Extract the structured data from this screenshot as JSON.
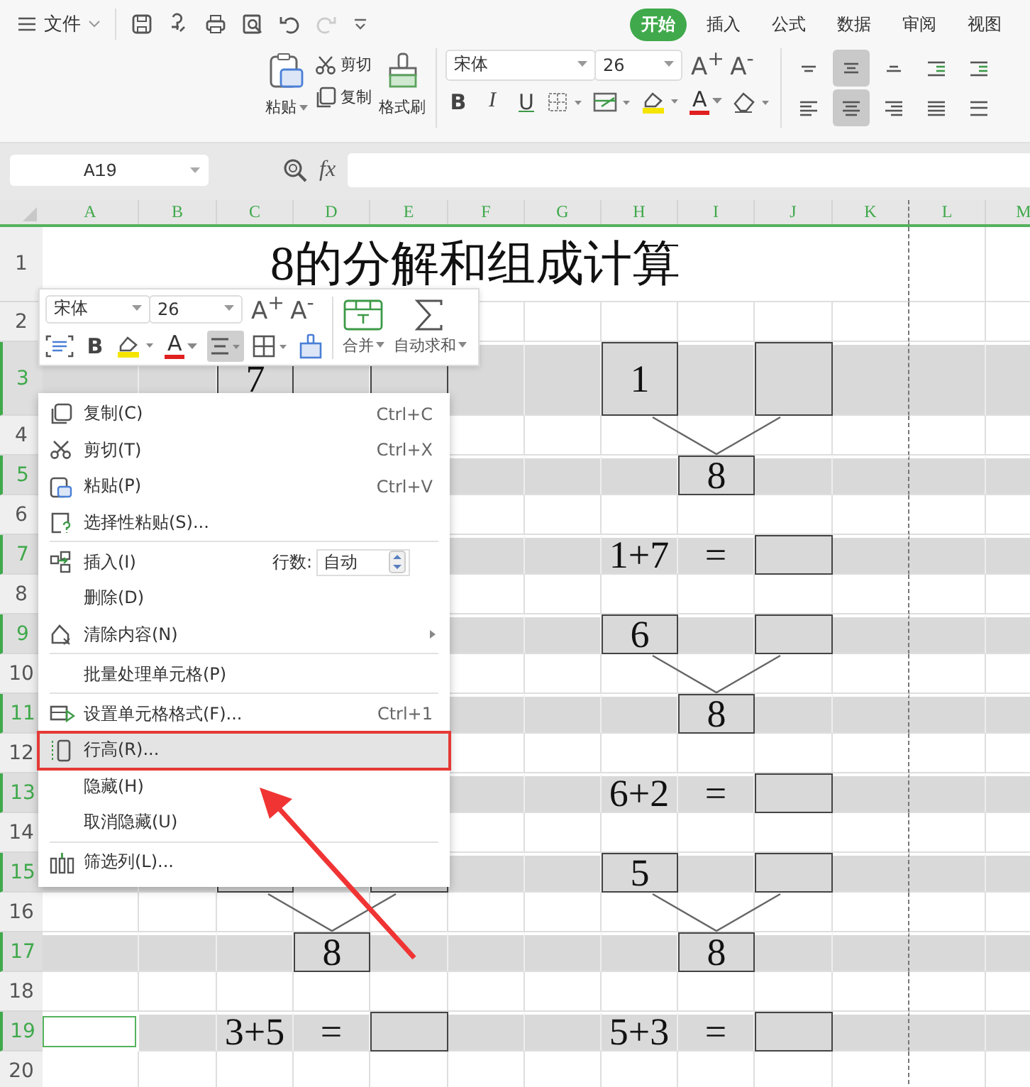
{
  "menu_bar": {
    "file_menu": "文件",
    "tabs": [
      {
        "label": "开始",
        "selected": true
      },
      {
        "label": "插入",
        "selected": false
      },
      {
        "label": "公式",
        "selected": false
      },
      {
        "label": "数据",
        "selected": false
      },
      {
        "label": "审阅",
        "selected": false
      },
      {
        "label": "视图",
        "selected": false
      }
    ]
  },
  "ribbon": {
    "paste": "粘贴",
    "cut": "剪切",
    "copy": "复制",
    "format_painter": "格式刷",
    "font_name": "宋体",
    "font_size": "26",
    "grow_font": "A$^{+}$",
    "shrink_font": "A$^{-}$",
    "format_buttons": [
      {
        "kind": "bold",
        "glyph": "B"
      },
      {
        "kind": "italic",
        "glyph": "I"
      },
      {
        "kind": "underline",
        "glyph": "U"
      }
    ],
    "font_color_glyph": "A",
    "alignment": [
      {
        "selected": false
      },
      {
        "selected": true
      },
      {
        "selected": false
      },
      {
        "selected": false
      },
      {
        "selected": false
      },
      {
        "selected": false
      },
      {
        "selected": true
      },
      {
        "selected": false
      },
      {
        "selected": false
      },
      {
        "selected": false
      }
    ]
  },
  "formula_bar": {
    "name_box": "A19",
    "fx": "fx"
  },
  "sheet": {
    "columns": [
      "A",
      "B",
      "C",
      "D",
      "E",
      "F",
      "G",
      "H",
      "I",
      "J",
      "K",
      "L",
      "M"
    ],
    "rows": [
      {
        "number": "1",
        "selected": false,
        "title": "8的分解和组成计算"
      },
      {
        "number": "2",
        "selected": false
      },
      {
        "number": "3",
        "selected": true,
        "cells": [
          {
            "boxed": false
          },
          {
            "boxed": false
          },
          {
            "text": "7",
            "boxed": true
          },
          {
            "boxed": false
          },
          {
            "boxed": true
          },
          {
            "boxed": false
          },
          {
            "boxed": false
          },
          {
            "text": "1",
            "boxed": true
          },
          {
            "boxed": false
          },
          {
            "boxed": true
          },
          {
            "boxed": false
          },
          {
            "boxed": false
          },
          {
            "boxed": false
          }
        ]
      },
      {
        "number": "4",
        "selected": false,
        "cells": [
          {},
          {},
          {},
          {},
          {},
          {
            "boxed": false,
            "split_lines": false
          },
          {
            "boxed": false,
            "split_lines": false
          },
          {
            "boxed": false,
            "split_lines": false
          },
          {
            "boxed": false,
            "split_lines": true
          },
          {
            "boxed": false,
            "split_lines": false
          },
          {
            "boxed": false,
            "split_lines": false
          },
          {
            "boxed": false,
            "split_lines": false
          },
          {
            "boxed": false,
            "split_lines": false
          }
        ]
      },
      {
        "number": "5",
        "selected": true,
        "cells": [
          {},
          {},
          {},
          {},
          {},
          {
            "boxed": false
          },
          {
            "boxed": false
          },
          {
            "boxed": false
          },
          {
            "text": "8",
            "boxed": true
          },
          {
            "boxed": false
          },
          {
            "boxed": false
          },
          {
            "boxed": false
          },
          {
            "boxed": false
          }
        ]
      },
      {
        "number": "6",
        "selected": false
      },
      {
        "number": "7",
        "selected": true,
        "cells": [
          {},
          {},
          {},
          {},
          {},
          {
            "boxed": false
          },
          {
            "boxed": false
          },
          {
            "text": "1+7",
            "boxed": false
          },
          {
            "text": "=",
            "boxed": false
          },
          {
            "boxed": true
          },
          {
            "boxed": false
          },
          {
            "boxed": false
          },
          {
            "boxed": false
          }
        ]
      },
      {
        "number": "8",
        "selected": false
      },
      {
        "number": "9",
        "selected": true,
        "cells": [
          {},
          {},
          {},
          {},
          {},
          {
            "boxed": false
          },
          {
            "boxed": false
          },
          {
            "text": "6",
            "boxed": true
          },
          {
            "boxed": false
          },
          {
            "boxed": true
          },
          {
            "boxed": false
          },
          {
            "boxed": false
          },
          {
            "boxed": false
          }
        ]
      },
      {
        "number": "10",
        "selected": false,
        "cells": [
          {},
          {},
          {},
          {},
          {},
          {
            "boxed": false,
            "split_lines": false
          },
          {
            "boxed": false,
            "split_lines": false
          },
          {
            "boxed": false,
            "split_lines": false
          },
          {
            "boxed": false,
            "split_lines": true
          },
          {
            "boxed": false,
            "split_lines": false
          },
          {
            "boxed": false,
            "split_lines": false
          },
          {
            "boxed": false,
            "split_lines": false
          },
          {
            "boxed": false,
            "split_lines": false
          }
        ]
      },
      {
        "number": "11",
        "selected": true,
        "cells": [
          {},
          {},
          {},
          {},
          {},
          {
            "boxed": false
          },
          {
            "boxed": false
          },
          {
            "boxed": false
          },
          {
            "text": "8",
            "boxed": true
          },
          {
            "boxed": false
          },
          {
            "boxed": false
          },
          {
            "boxed": false
          },
          {
            "boxed": false
          }
        ]
      },
      {
        "number": "12",
        "selected": false
      },
      {
        "number": "13",
        "selected": true,
        "cells": [
          {},
          {},
          {},
          {},
          {},
          {
            "boxed": false
          },
          {
            "boxed": false
          },
          {
            "text": "6+2",
            "boxed": false
          },
          {
            "text": "=",
            "boxed": false
          },
          {
            "boxed": true
          },
          {
            "boxed": false
          },
          {
            "boxed": false
          },
          {
            "boxed": false
          }
        ]
      },
      {
        "number": "14",
        "selected": false
      },
      {
        "number": "15",
        "selected": true,
        "cells": [
          {
            "boxed": false
          },
          {
            "boxed": false
          },
          {
            "boxed": true
          },
          {
            "boxed": false
          },
          {
            "boxed": true
          },
          {
            "boxed": false
          },
          {
            "boxed": false
          },
          {
            "text": "5",
            "boxed": true
          },
          {
            "boxed": false
          },
          {
            "boxed": true
          },
          {
            "boxed": false
          },
          {
            "boxed": false
          },
          {
            "boxed": false
          }
        ]
      },
      {
        "number": "16",
        "selected": false,
        "cells": [
          {
            "boxed": false,
            "split_lines": false
          },
          {
            "boxed": false,
            "split_lines": false
          },
          {
            "boxed": false,
            "split_lines": false
          },
          {
            "boxed": false,
            "split_lines": true
          },
          {
            "boxed": false,
            "split_lines": false
          },
          {
            "boxed": false,
            "split_lines": false
          },
          {
            "boxed": false,
            "split_lines": false
          },
          {
            "boxed": false,
            "split_lines": false
          },
          {
            "boxed": false,
            "split_lines": true
          },
          {
            "boxed": false,
            "split_lines": false
          },
          {
            "boxed": false,
            "split_lines": false
          },
          {
            "boxed": false,
            "split_lines": false
          },
          {
            "boxed": false,
            "split_lines": false
          }
        ]
      },
      {
        "number": "17",
        "selected": true,
        "cells": [
          {
            "boxed": false
          },
          {
            "boxed": false
          },
          {
            "boxed": false
          },
          {
            "text": "8",
            "boxed": true
          },
          {
            "boxed": false
          },
          {
            "boxed": false
          },
          {
            "boxed": false
          },
          {
            "boxed": false
          },
          {
            "text": "8",
            "boxed": true
          },
          {
            "boxed": false
          },
          {
            "boxed": false
          },
          {
            "boxed": false
          },
          {
            "boxed": false
          }
        ]
      },
      {
        "number": "18",
        "selected": false
      },
      {
        "number": "19",
        "selected": true,
        "cells": [
          {
            "boxed": false,
            "active": true
          },
          {
            "boxed": false,
            "active": false
          },
          {
            "text": "3+5",
            "boxed": false,
            "active": false
          },
          {
            "text": "=",
            "boxed": false,
            "active": false
          },
          {
            "boxed": true,
            "active": false
          },
          {
            "boxed": false,
            "active": false
          },
          {
            "boxed": false,
            "active": false
          },
          {
            "text": "5+3",
            "boxed": false,
            "active": false
          },
          {
            "text": "=",
            "boxed": false,
            "active": false
          },
          {
            "boxed": true,
            "active": false
          },
          {
            "boxed": false,
            "active": false
          },
          {
            "boxed": false,
            "active": false
          },
          {
            "boxed": false,
            "active": false
          }
        ]
      },
      {
        "number": "20",
        "selected": false
      }
    ]
  },
  "mini_toolbar": {
    "font_name": "宋体",
    "font_size": "26",
    "grow_font": "A$^{+}$",
    "shrink_font": "A$^{-}$",
    "bold_glyph": "B",
    "font_color_glyph": "A",
    "align_selected": true,
    "merge": "合并",
    "autosum": "自动求和"
  },
  "context_menu": {
    "items": [
      {
        "label": "复制(C)",
        "shortcut": "Ctrl+C",
        "divider_above": false,
        "has_submenu": false,
        "selected": false,
        "highlighted": false
      },
      {
        "label": "剪切(T)",
        "shortcut": "Ctrl+X",
        "divider_above": false,
        "has_submenu": false,
        "selected": false,
        "highlighted": false
      },
      {
        "label": "粘贴(P)",
        "shortcut": "Ctrl+V",
        "divider_above": false,
        "has_submenu": false,
        "selected": false,
        "highlighted": false
      },
      {
        "label": "选择性粘贴(S)...",
        "divider_above": false,
        "has_submenu": false,
        "selected": false,
        "highlighted": false
      },
      {
        "label": "插入(I)",
        "row_count_label": "行数:",
        "row_count": "自动",
        "divider_above": true,
        "has_submenu": false,
        "selected": false,
        "highlighted": false
      },
      {
        "label": "删除(D)",
        "divider_above": false,
        "has_submenu": false,
        "selected": false,
        "highlighted": false
      },
      {
        "label": "清除内容(N)",
        "divider_above": false,
        "has_submenu": true,
        "selected": false,
        "highlighted": false
      },
      {
        "label": "批量处理单元格(P)",
        "divider_above": true,
        "has_submenu": false,
        "selected": false,
        "highlighted": false
      },
      {
        "label": "设置单元格格式(F)...",
        "shortcut": "Ctrl+1",
        "divider_above": true,
        "has_submenu": false,
        "selected": false,
        "highlighted": false
      },
      {
        "label": "行高(R)...",
        "divider_above": false,
        "has_submenu": false,
        "selected": true,
        "highlighted": true
      },
      {
        "label": "隐藏(H)",
        "divider_above": false,
        "has_submenu": false,
        "selected": false,
        "highlighted": false
      },
      {
        "label": "取消隐藏(U)",
        "divider_above": false,
        "has_submenu": false,
        "selected": false,
        "highlighted": false
      },
      {
        "label": "筛选列(L)...",
        "divider_above": true,
        "has_submenu": false,
        "selected": false,
        "highlighted": false
      }
    ]
  }
}
